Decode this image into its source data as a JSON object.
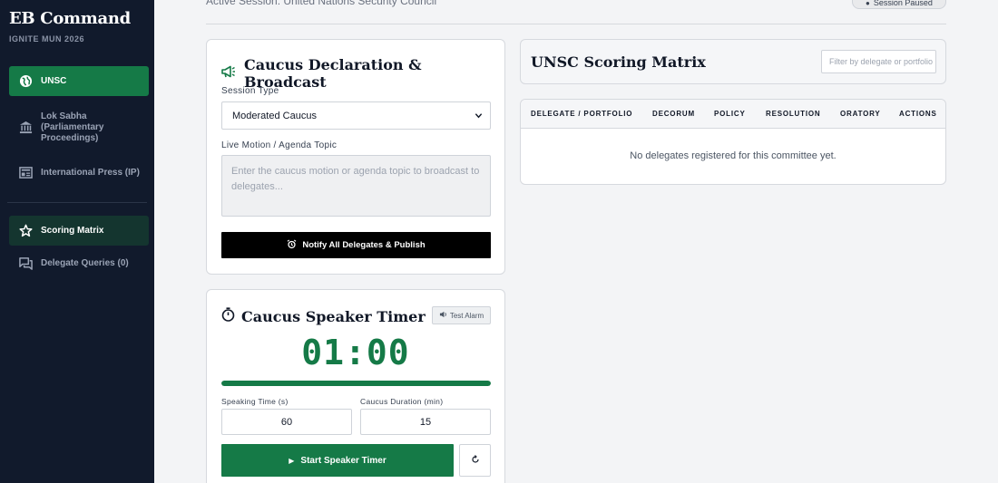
{
  "sidebar": {
    "title": "EB Command",
    "subtitle": "IGNITE MUN 2026",
    "items": [
      {
        "label": "UNSC",
        "icon": "globe-icon"
      },
      {
        "label": "Lok Sabha (Parliamentary Proceedings)",
        "icon": "parliament-icon"
      },
      {
        "label": "International Press (IP)",
        "icon": "newspaper-icon"
      },
      {
        "label": "Scoring Matrix",
        "icon": "star-icon"
      },
      {
        "label": "Delegate Queries (0)",
        "icon": "chat-icon"
      }
    ]
  },
  "header": {
    "session": "Active Session: United Nations Security Council",
    "pause_label": "Session Paused"
  },
  "caucus": {
    "title": "Caucus Declaration & Broadcast",
    "session_type_label": "Session Type",
    "session_type_value": "Moderated Caucus",
    "motion_label": "Live Motion / Agenda Topic",
    "motion_placeholder": "Enter the caucus motion or agenda topic to broadcast to delegates...",
    "notify_label": "Notify All Delegates & Publish"
  },
  "timer": {
    "title": "Caucus Speaker Timer",
    "test_alarm_label": "Test Alarm",
    "display": "01:00",
    "progress": 1.0,
    "speaking_time_label": "Speaking Time (s)",
    "speaking_time_value": "60",
    "duration_label": "Caucus Duration (min)",
    "duration_value": "15",
    "start_label": "Start Speaker Timer"
  },
  "matrix": {
    "title": "UNSC Scoring Matrix",
    "filter_placeholder": "Filter by delegate or portfolio",
    "columns": [
      "DELEGATE / PORTFOLIO",
      "DECORUM",
      "POLICY",
      "RESOLUTION",
      "ORATORY",
      "ACTIONS"
    ],
    "empty_message": "No delegates registered for this committee yet."
  },
  "colors": {
    "accent": "#157a47",
    "sidebar_bg": "#111a2c",
    "active_dark": "#14352f"
  }
}
